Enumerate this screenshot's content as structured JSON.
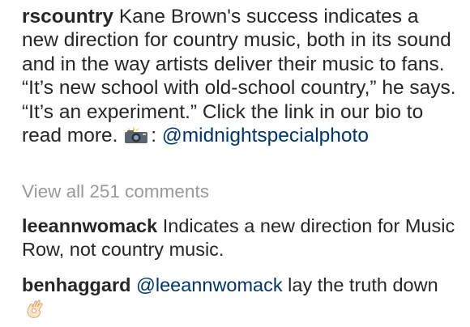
{
  "caption": {
    "username": "rscountry",
    "text": " Kane Brown's success indicates a new direction for country music, both in its sound and in the way artists deliver their music to fans. “It’s new school with old-school country,” he says. “It’s an experiment.” Click the link in our bio to read more. ",
    "camera_icon": "camera-flash-icon",
    "credit_sep": ": ",
    "credit_mention": "@midnightspecialphoto"
  },
  "view_all": "View all 251 comments",
  "comments": [
    {
      "username": "leeannwomack",
      "text": " Indicates a new direction for Music Row, not country music."
    },
    {
      "username": "benhaggard",
      "mention": "@leeannwomack",
      "text": " lay the truth down",
      "emoji": "ok-hand-icon"
    }
  ]
}
